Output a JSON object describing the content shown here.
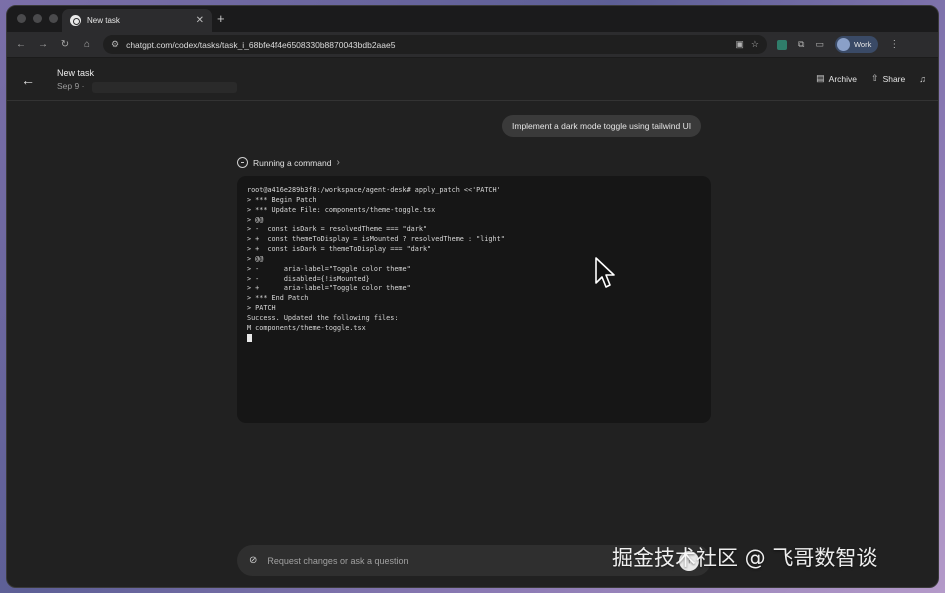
{
  "browser": {
    "tab_title": "New task",
    "new_tab_symbol": "+",
    "url": "chatgpt.com/codex/tasks/task_i_68bfe4f4e6508330b8870043bdb2aae5",
    "profile_label": "Work"
  },
  "header": {
    "title": "New task",
    "date": "Sep 9  ·",
    "archive_label": "Archive",
    "share_label": "Share"
  },
  "conversation": {
    "user_message": "Implement a dark mode toggle using tailwind UI",
    "status_label": "Running a command"
  },
  "terminal": {
    "lines": [
      "root@a416e289b3f8:/workspace/agent-desk# apply_patch <<'PATCH'",
      "> *** Begin Patch",
      "> *** Update File: components/theme-toggle.tsx",
      "> @@",
      "> -  const isDark = resolvedTheme === \"dark\"",
      "> +  const themeToDisplay = isMounted ? resolvedTheme : \"light\"",
      "> +  const isDark = themeToDisplay === \"dark\"",
      "> @@",
      "> -      aria-label=\"Toggle color theme\"",
      "> -      disabled={!isMounted}",
      "> +      aria-label=\"Toggle color theme\"",
      "> *** End Patch",
      "> PATCH",
      "Success. Updated the following files:",
      "M components/theme-toggle.tsx"
    ]
  },
  "composer": {
    "placeholder": "Request changes or ask a question"
  },
  "watermark": "掘金技术社区 @ 飞哥数智谈"
}
